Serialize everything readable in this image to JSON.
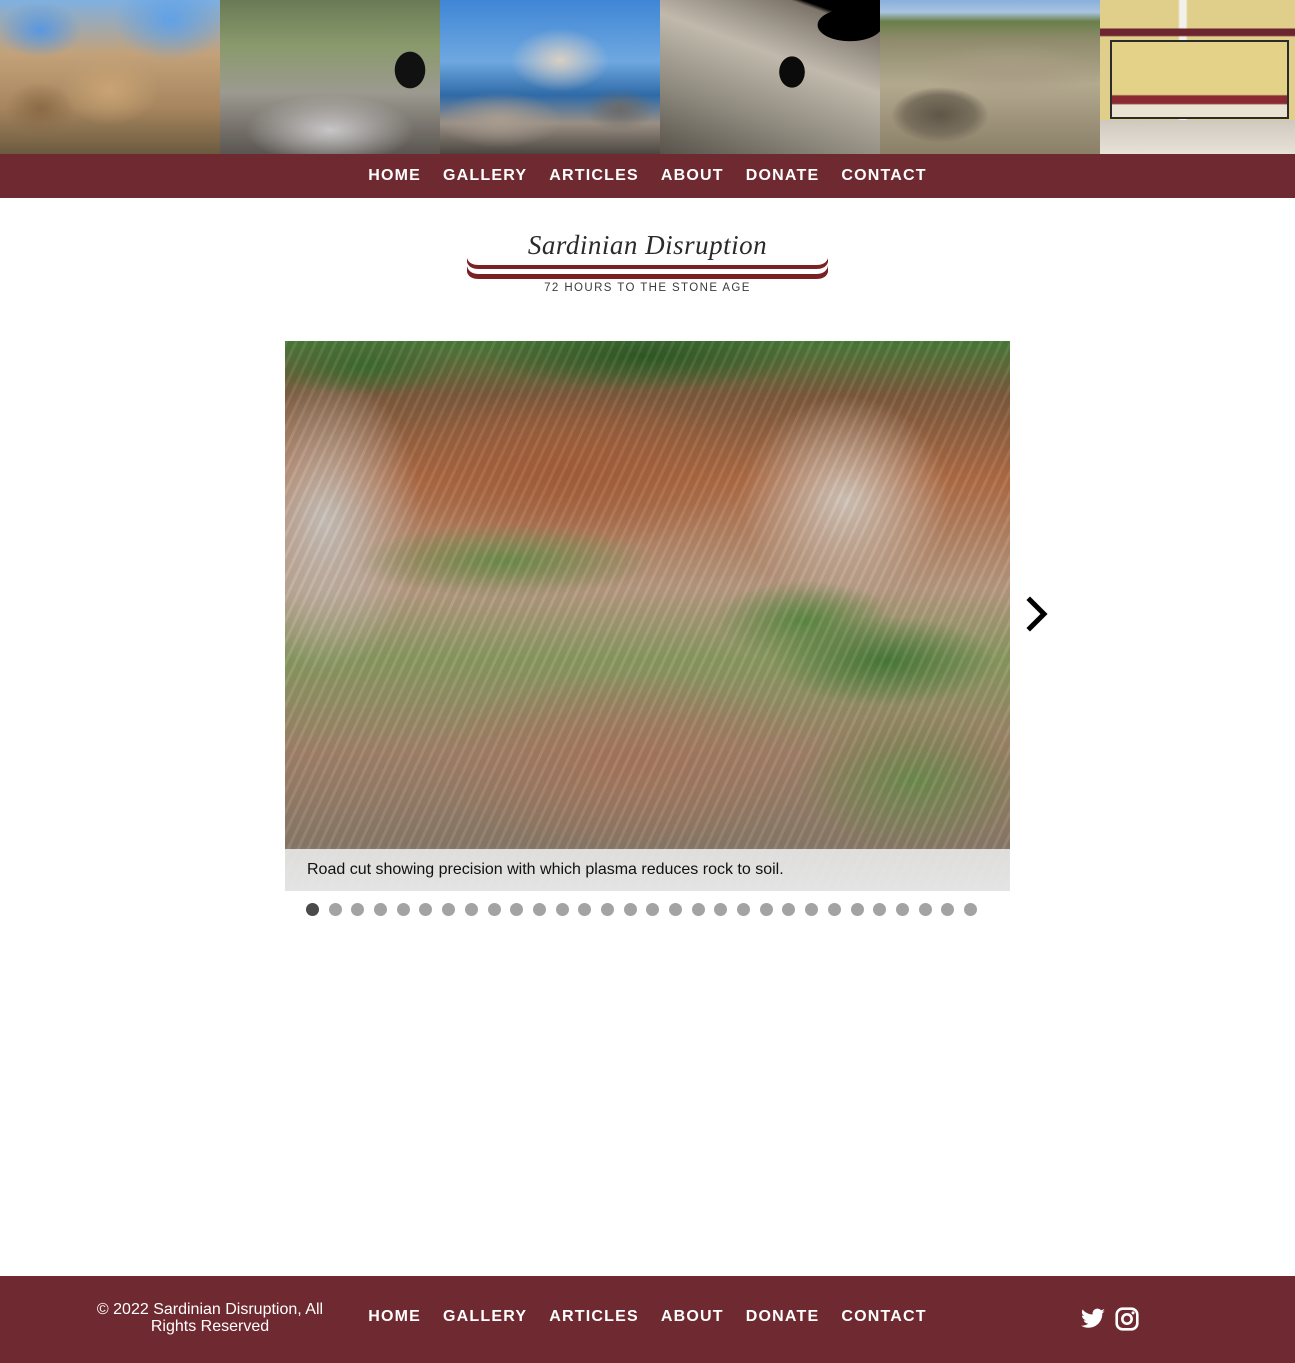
{
  "nav": {
    "items": [
      {
        "label": "HOME"
      },
      {
        "label": "GALLERY"
      },
      {
        "label": "ARTICLES"
      },
      {
        "label": "ABOUT"
      },
      {
        "label": "DONATE"
      },
      {
        "label": "CONTACT"
      }
    ]
  },
  "logo": {
    "title": "Sardinian Disruption",
    "subtitle": "72 HOURS TO THE STONE AGE"
  },
  "slideshow": {
    "caption": "Road cut showing precision with which plasma reduces rock to soil.",
    "total_slides": 30,
    "active_index": 0
  },
  "footer": {
    "copyright_line1": "© 2022 Sardinian Disruption, All",
    "copyright_line2": "Rights Reserved",
    "social": [
      {
        "icon": "twitter-icon"
      },
      {
        "icon": "instagram-icon"
      }
    ]
  },
  "colors": {
    "brand": "#6f2a31",
    "dot_inactive": "#a3a3a3",
    "dot_active": "#4a4a4a"
  }
}
